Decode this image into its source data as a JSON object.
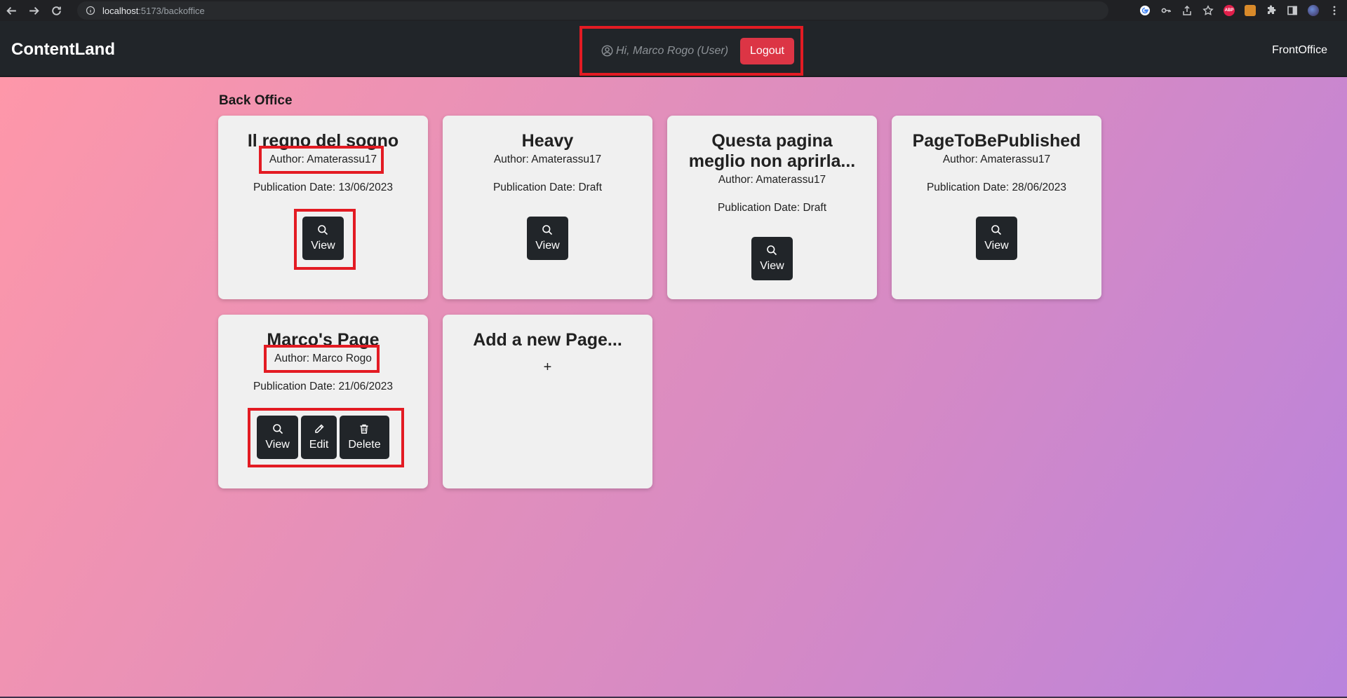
{
  "browser": {
    "url_host": "localhost",
    "url_rest": ":5173/backoffice",
    "icons": [
      "back-icon",
      "forward-icon",
      "reload-icon",
      "info-icon",
      "google-icon",
      "key-icon",
      "share-icon",
      "star-icon",
      "adblock-icon",
      "extension-icon",
      "puzzle-icon",
      "sidepanel-icon",
      "profile-avatar",
      "menu-icon"
    ]
  },
  "navbar": {
    "brand": "ContentLand",
    "greeting": "Hi, Marco Rogo (User)",
    "logout_label": "Logout",
    "frontoffice_label": "FrontOffice"
  },
  "main": {
    "section_title": "Back Office",
    "cards": [
      {
        "title": "Il regno del sogno",
        "author": "Author: Amaterassu17",
        "date": "Publication Date: 13/06/2023",
        "view_label": "View"
      },
      {
        "title": "Heavy",
        "author": "Author: Amaterassu17",
        "date": "Publication Date: Draft",
        "view_label": "View"
      },
      {
        "title_line1": "Questa pagina",
        "title_line2": "meglio non aprirla...",
        "author": "Author: Amaterassu17",
        "date": "Publication Date: Draft",
        "view_label": "View"
      },
      {
        "title": "PageToBePublished",
        "author": "Author: Amaterassu17",
        "date": "Publication Date: 28/06/2023",
        "view_label": "View"
      },
      {
        "title": "Marco's Page",
        "author": "Author: Marco Rogo",
        "date": "Publication Date: 21/06/2023",
        "view_label": "View",
        "edit_label": "Edit",
        "delete_label": "Delete"
      }
    ],
    "add_card": {
      "title": "Add a new Page...",
      "plus": "+"
    }
  },
  "colors": {
    "navbar_bg": "#212529",
    "logout_bg": "#dc3545",
    "highlight": "#e31b23",
    "gradient_start": "#fe97a9",
    "gradient_end": "#b983dd"
  }
}
